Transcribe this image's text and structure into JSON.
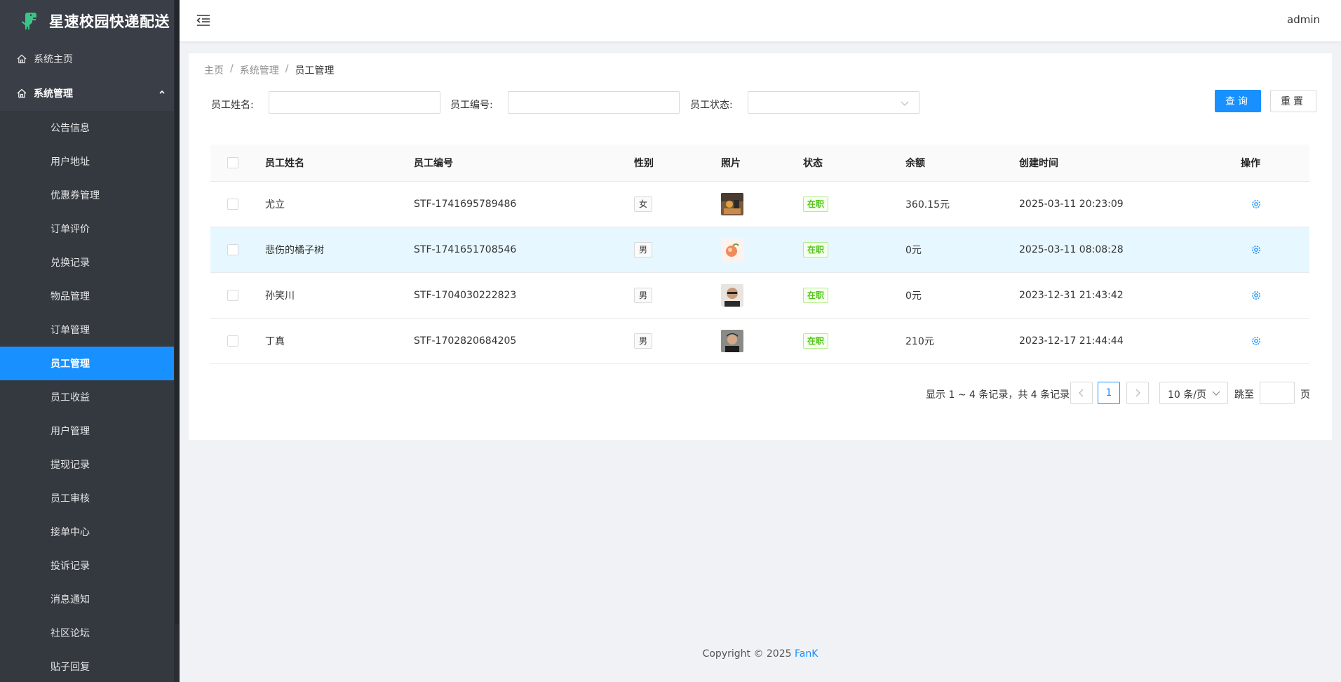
{
  "app": {
    "title": "星速校园快递配送"
  },
  "sidebar": {
    "home": "系统主页",
    "group": "系统管理",
    "items": [
      {
        "label": "公告信息"
      },
      {
        "label": "用户地址"
      },
      {
        "label": "优惠券管理"
      },
      {
        "label": "订单评价"
      },
      {
        "label": "兑换记录"
      },
      {
        "label": "物品管理"
      },
      {
        "label": "订单管理"
      },
      {
        "label": "员工管理",
        "active": true
      },
      {
        "label": "员工收益"
      },
      {
        "label": "用户管理"
      },
      {
        "label": "提现记录"
      },
      {
        "label": "员工审核"
      },
      {
        "label": "接单中心"
      },
      {
        "label": "投诉记录"
      },
      {
        "label": "消息通知"
      },
      {
        "label": "社区论坛"
      },
      {
        "label": "贴子回复"
      }
    ]
  },
  "header": {
    "user": "admin"
  },
  "breadcrumb": {
    "home": "主页",
    "parent": "系统管理",
    "current": "员工管理",
    "sep": "/"
  },
  "search": {
    "name_label": "员工姓名:",
    "name_value": "",
    "code_label": "员工编号:",
    "code_value": "",
    "status_label": "员工状态:",
    "status_value": "",
    "query_btn": "查询",
    "reset_btn": "重置"
  },
  "table": {
    "columns": {
      "name": "员工姓名",
      "code": "员工编号",
      "gender": "性别",
      "photo": "照片",
      "status": "状态",
      "balance": "余额",
      "created": "创建时间",
      "action": "操作"
    },
    "rows": [
      {
        "name": "尤立",
        "code": "STF-1741695789486",
        "gender": "女",
        "status": "在职",
        "balance": "360.15元",
        "created": "2025-03-11 20:23:09"
      },
      {
        "name": "悲伤的橘子树",
        "code": "STF-1741651708546",
        "gender": "男",
        "status": "在职",
        "balance": "0元",
        "created": "2025-03-11 08:08:28"
      },
      {
        "name": "孙笑川",
        "code": "STF-1704030222823",
        "gender": "男",
        "status": "在职",
        "balance": "0元",
        "created": "2023-12-31 21:43:42"
      },
      {
        "name": "丁真",
        "code": "STF-1702820684205",
        "gender": "男",
        "status": "在职",
        "balance": "210元",
        "created": "2023-12-17 21:44:44"
      }
    ]
  },
  "pagination": {
    "total_text": "显示 1 ~ 4 条记录，共 4 条记录",
    "current_page": "1",
    "page_size": "10 条/页",
    "jump_label": "跳至",
    "jump_suffix": "页"
  },
  "footer": {
    "copyright": "Copyright © 2025 ",
    "brand": "FanK"
  },
  "colors": {
    "primary": "#1890ff",
    "sidebar": "#3a3f47",
    "success": "#52c41a"
  }
}
